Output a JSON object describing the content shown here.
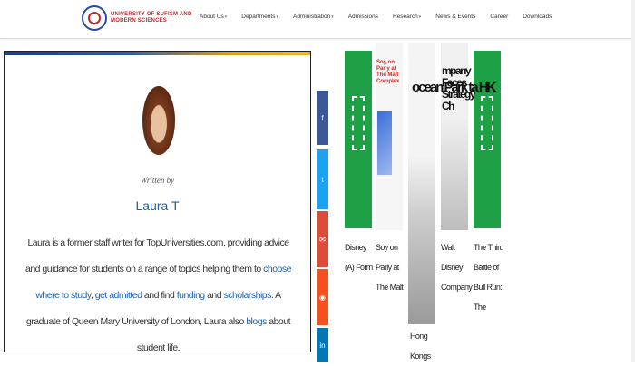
{
  "header": {
    "logo_text": "UNIVERSITY OF SUFISM AND MODERN SCIENCES",
    "nav": [
      {
        "label": "About Us",
        "dropdown": true
      },
      {
        "label": "Departments",
        "dropdown": true
      },
      {
        "label": "Administration",
        "dropdown": true
      },
      {
        "label": "Admissions",
        "dropdown": false
      },
      {
        "label": "Research",
        "dropdown": true
      },
      {
        "label": "News & Events",
        "dropdown": false
      },
      {
        "label": "Career",
        "dropdown": false
      },
      {
        "label": "Downloads",
        "dropdown": false
      }
    ]
  },
  "author": {
    "written_by": "Written by",
    "name": "Laura T",
    "bio_1": "Laura is a former staff writer for TopUniversities.com, providing advice and guidance for students on a range of topics helping them to ",
    "link_choose": "choose where to study",
    "sep_1": ", ",
    "link_admitted": "get admitted",
    "bio_2": " and find ",
    "link_funding": "funding",
    "bio_3": " and ",
    "link_scholarships": "scholarships",
    "bio_4": ". A graduate of Queen Mary University of London, Laura also ",
    "link_blogs": "blogs",
    "bio_5": " about student life."
  },
  "share": {
    "facebook": "f",
    "twitter": "t",
    "email": "✉",
    "reddit": "◉",
    "linkedin": "in"
  },
  "books": [
    {
      "caption": "Disney (A) Form"
    },
    {
      "caption": "Soy on Parly at The Malt",
      "cover_text": "Soy on Parly at The Malt Complex"
    },
    {
      "caption": "Hong Kongs",
      "cover_text": "ocean Park ta HK"
    },
    {
      "caption": "Walt Disney Company",
      "cover_text": "mpany Faces Strategy Ch"
    },
    {
      "caption": "The Third Battle of Bull Run: The"
    }
  ],
  "colors": {
    "accent_link": "#1d5fa8",
    "facebook": "#3b5998",
    "twitter": "#1da1f2",
    "email": "#dd4b39",
    "reddit": "#f4511e",
    "linkedin": "#0077b5",
    "book_green": "#1fa046"
  }
}
